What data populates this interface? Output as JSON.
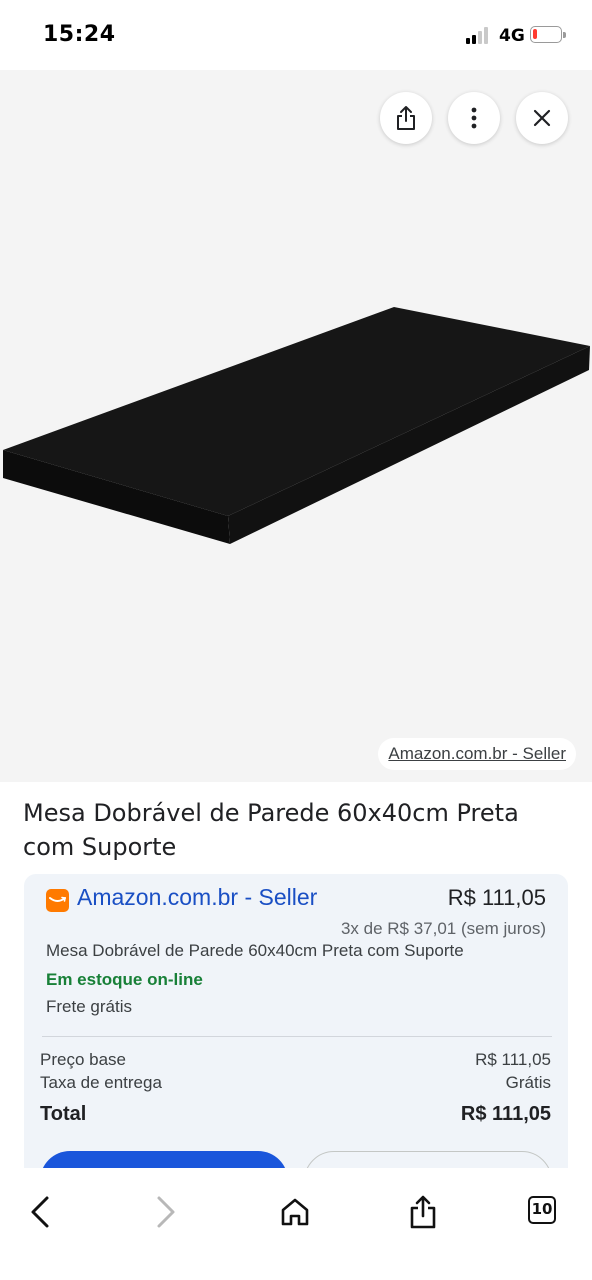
{
  "status_bar": {
    "time": "15:24",
    "network": "4G",
    "signal_bars_on": 2,
    "signal_bars_total": 4,
    "battery_level": 0.15,
    "battery_color": "#ff3b30"
  },
  "image_viewer": {
    "share_icon": "share-icon",
    "more_icon": "more-vert-icon",
    "close_icon": "close-icon",
    "source_label": "Amazon.com.br - Seller"
  },
  "product": {
    "title": "Mesa Dobrável de Parede 60x40cm Preta com Suporte"
  },
  "offer": {
    "seller_logo_icon": "amazon-logo-icon",
    "seller_logo_color": "#ff7a00",
    "seller_name": "Amazon.com.br - Seller",
    "price": "R$ 111,05",
    "installments": "3x de R$ 37,01 (sem juros)",
    "description": "Mesa Dobrável de Parede 60x40cm Preta com Suporte",
    "stock": "Em estoque on-line",
    "stock_color": "#188038",
    "shipping": "Frete grátis",
    "base_price_label": "Preço base",
    "base_price_value": "R$ 111,05",
    "delivery_fee_label": "Taxa de entrega",
    "delivery_fee_value": "Grátis",
    "total_label": "Total",
    "total_value": "R$ 111,05",
    "accent_color": "#1a56db"
  },
  "bottom_nav": {
    "back_icon": "chevron-left-icon",
    "forward_icon": "chevron-right-icon",
    "home_icon": "home-icon",
    "share_icon": "share-icon",
    "tabs_count": "10"
  }
}
